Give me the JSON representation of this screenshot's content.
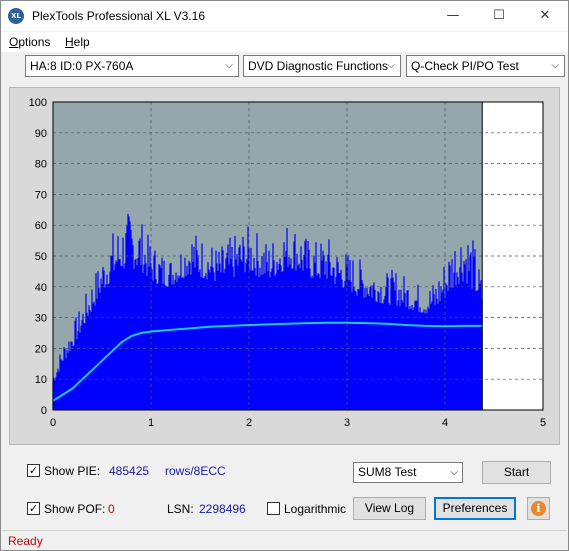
{
  "window": {
    "title": "PlexTools Professional XL V3.16",
    "app_icon_text": "XL",
    "minimize_glyph": "—",
    "maximize_glyph": "☐",
    "close_glyph": "✕"
  },
  "menu": {
    "items": [
      {
        "underline": "O",
        "rest": "ptions"
      },
      {
        "underline": "H",
        "rest": "elp"
      }
    ]
  },
  "toolbar": {
    "drive_select": "HA:8 ID:0  PX-760A",
    "function_select": "DVD Diagnostic Functions",
    "test_select": "Q-Check PI/PO Test",
    "arrow_glyph": "⌵"
  },
  "colors": {
    "plot_bg": "#93a7ad",
    "bar_fill": "#0000ff",
    "avg_line": "#1ec8e8",
    "grid": "#555555",
    "outside_bg": "#d9d9d9"
  },
  "chart_data": {
    "type": "area",
    "x_ticks": [
      "0",
      "1",
      "2",
      "3",
      "4",
      "5"
    ],
    "y_ticks": [
      "0",
      "10",
      "20",
      "30",
      "40",
      "50",
      "60",
      "70",
      "80",
      "90",
      "100"
    ],
    "xlim": [
      0,
      5
    ],
    "ylim": [
      0,
      100
    ],
    "data_end_x": 4.38,
    "grid": true,
    "series": [
      {
        "key": "pie_bars",
        "x": [
          0,
          0.1,
          0.2,
          0.3,
          0.4,
          0.5,
          0.6,
          0.7,
          0.8,
          0.9,
          1.0,
          1.1,
          1.2,
          1.3,
          1.4,
          1.5,
          1.6,
          1.7,
          1.8,
          1.9,
          2.0,
          2.1,
          2.2,
          2.3,
          2.4,
          2.5,
          2.6,
          2.7,
          2.8,
          2.9,
          3.0,
          3.1,
          3.2,
          3.3,
          3.4,
          3.5,
          3.6,
          3.7,
          3.8,
          3.9,
          4.0,
          4.1,
          4.2,
          4.3,
          4.38
        ],
        "peaks": [
          12,
          22,
          28,
          35,
          43,
          50,
          58,
          62,
          66,
          62,
          55,
          52,
          50,
          54,
          60,
          57,
          55,
          53,
          56,
          58,
          60,
          58,
          55,
          58,
          62,
          60,
          56,
          55,
          57,
          53,
          52,
          50,
          48,
          47,
          45,
          46,
          44,
          42,
          40,
          43,
          50,
          58,
          62,
          55,
          42
        ],
        "base": [
          8,
          15,
          20,
          26,
          32,
          38,
          42,
          45,
          46,
          45,
          42,
          40,
          40,
          42,
          44,
          43,
          42,
          41,
          42,
          44,
          45,
          43,
          42,
          44,
          46,
          45,
          43,
          42,
          42,
          40,
          39,
          37,
          36,
          35,
          34,
          34,
          33,
          32,
          31,
          32,
          36,
          40,
          42,
          38,
          34
        ]
      },
      {
        "key": "pie_avg",
        "x": [
          0,
          0.1,
          0.2,
          0.3,
          0.4,
          0.5,
          0.6,
          0.7,
          0.8,
          0.9,
          1.0,
          1.2,
          1.4,
          1.6,
          1.8,
          2.0,
          2.2,
          2.4,
          2.6,
          2.8,
          3.0,
          3.2,
          3.4,
          3.6,
          3.8,
          4.0,
          4.2,
          4.38
        ],
        "values": [
          3,
          5,
          7,
          10,
          13,
          16,
          19,
          22,
          24,
          25,
          25.5,
          26,
          26.5,
          27,
          27.3,
          27.6,
          27.8,
          28,
          28.2,
          28.3,
          28.3,
          28.2,
          28,
          27.6,
          27.3,
          27.2,
          27.3,
          27.3
        ]
      }
    ]
  },
  "bottom": {
    "show_pie_label": "Show PIE:",
    "show_pie_value": "485425",
    "rows_label": "rows/8ECC",
    "show_pof_label": "Show POF:",
    "show_pof_value": "0",
    "lsn_label": "LSN:",
    "lsn_value": "2298496",
    "log_label": "Logarithmic",
    "sum8_select": "SUM8 Test",
    "start_button": "Start",
    "view_log_button": "View Log",
    "preferences_button": "Preferences",
    "info_glyph": "i",
    "check_glyph": "✓",
    "show_pie_checked": true,
    "show_pof_checked": true,
    "log_checked": false
  },
  "status": {
    "text": "Ready"
  }
}
